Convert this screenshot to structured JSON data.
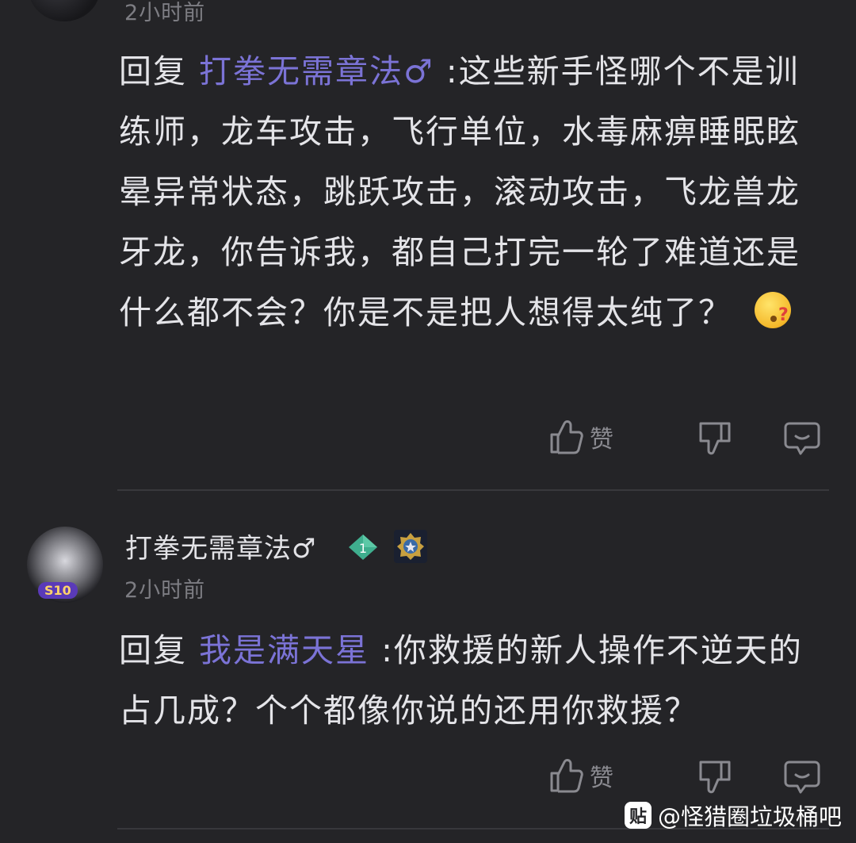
{
  "comment1": {
    "time": "2小时前",
    "reply_label": "回复",
    "mention": "打拳无需章法♂",
    "text": " :这些新手怪哪个不是训练师，龙车攻击，飞行单位，水毒麻痹睡眠眩晕异常状态，跳跃攻击，滚动攻击，飞龙兽龙牙龙，你告诉我，都自己打完一轮了难道还是什么都不会？你是不是把人想得太纯了？",
    "emoji": "疑问表情",
    "like_label": "赞"
  },
  "comment2": {
    "username": "打拳无需章法♂",
    "level": "1",
    "avatar_badge": "S10",
    "time": "2小时前",
    "reply_label": "回复",
    "mention": "我是满天星",
    "text": " :你救援的新人操作不逆天的占几成？个个都像你说的还用你救援？",
    "like_label": "赞"
  },
  "watermark": {
    "icon": "贴",
    "text": "@怪猎圈垃圾桶吧"
  },
  "colors": {
    "background": "#242427",
    "mention": "#7b73d6",
    "text": "#e4e4e8",
    "muted": "#7d7d83"
  }
}
